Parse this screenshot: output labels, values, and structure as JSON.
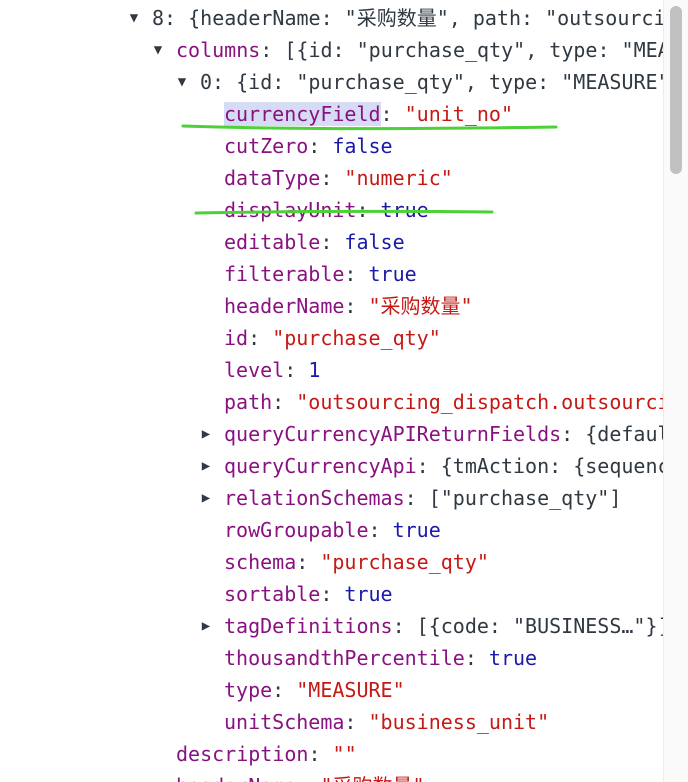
{
  "tree": {
    "rows": [
      {
        "indent": 0,
        "toggle": "expanded",
        "key": "8",
        "value": "{headerName: \"采购数量\", path: \"outsourcing_dispatch.outsourcing_dispatch_detail.purchase_qty\"…}",
        "keyStyle": "index",
        "valueStyle": "punct"
      },
      {
        "indent": 1,
        "toggle": "expanded",
        "key": "columns",
        "value": "[{id: \"purchase_qty\", type: \"MEASURE\"…}]",
        "keyStyle": "prop",
        "valueStyle": "punct"
      },
      {
        "indent": 2,
        "toggle": "expanded",
        "key": "0",
        "value": "{id: \"purchase_qty\", type: \"MEASURE\"…}",
        "keyStyle": "index",
        "valueStyle": "punct"
      },
      {
        "indent": 3,
        "toggle": "none",
        "key": "currencyField",
        "value": "\"unit_no\"",
        "keyStyle": "prop",
        "valueStyle": "string",
        "highlightKey": true
      },
      {
        "indent": 3,
        "toggle": "none",
        "key": "cutZero",
        "value": "false",
        "keyStyle": "prop",
        "valueStyle": "keyword"
      },
      {
        "indent": 3,
        "toggle": "none",
        "key": "dataType",
        "value": "\"numeric\"",
        "keyStyle": "prop",
        "valueStyle": "string"
      },
      {
        "indent": 3,
        "toggle": "none",
        "key": "displayUnit",
        "value": "true",
        "keyStyle": "prop",
        "valueStyle": "keyword"
      },
      {
        "indent": 3,
        "toggle": "none",
        "key": "editable",
        "value": "false",
        "keyStyle": "prop",
        "valueStyle": "keyword"
      },
      {
        "indent": 3,
        "toggle": "none",
        "key": "filterable",
        "value": "true",
        "keyStyle": "prop",
        "valueStyle": "keyword"
      },
      {
        "indent": 3,
        "toggle": "none",
        "key": "headerName",
        "value": "\"采购数量\"",
        "keyStyle": "prop",
        "valueStyle": "string"
      },
      {
        "indent": 3,
        "toggle": "none",
        "key": "id",
        "value": "\"purchase_qty\"",
        "keyStyle": "prop",
        "valueStyle": "string"
      },
      {
        "indent": 3,
        "toggle": "none",
        "key": "level",
        "value": "1",
        "keyStyle": "prop",
        "valueStyle": "keyword"
      },
      {
        "indent": 3,
        "toggle": "none",
        "key": "path",
        "value": "\"outsourcing_dispatch.outsourcing_dispatch_detail.purchase_qty\"",
        "keyStyle": "prop",
        "valueStyle": "string"
      },
      {
        "indent": 3,
        "toggle": "collapsed",
        "key": "queryCurrencyAPIReturnFields",
        "value": "{default: …}",
        "keyStyle": "prop",
        "valueStyle": "punct"
      },
      {
        "indent": 3,
        "toggle": "collapsed",
        "key": "queryCurrencyApi",
        "value": "{tmAction: {sequence: …}}",
        "keyStyle": "prop",
        "valueStyle": "punct"
      },
      {
        "indent": 3,
        "toggle": "collapsed",
        "key": "relationSchemas",
        "value": "[\"purchase_qty\"]",
        "keyStyle": "prop",
        "valueStyle": "punct"
      },
      {
        "indent": 3,
        "toggle": "none",
        "key": "rowGroupable",
        "value": "true",
        "keyStyle": "prop",
        "valueStyle": "keyword"
      },
      {
        "indent": 3,
        "toggle": "none",
        "key": "schema",
        "value": "\"purchase_qty\"",
        "keyStyle": "prop",
        "valueStyle": "string"
      },
      {
        "indent": 3,
        "toggle": "none",
        "key": "sortable",
        "value": "true",
        "keyStyle": "prop",
        "valueStyle": "keyword"
      },
      {
        "indent": 3,
        "toggle": "collapsed",
        "key": "tagDefinitions",
        "value": "[{code: \"BUSINESS…\"}]",
        "keyStyle": "prop",
        "valueStyle": "punct"
      },
      {
        "indent": 3,
        "toggle": "none",
        "key": "thousandthPercentile",
        "value": "true",
        "keyStyle": "prop",
        "valueStyle": "keyword"
      },
      {
        "indent": 3,
        "toggle": "none",
        "key": "type",
        "value": "\"MEASURE\"",
        "keyStyle": "prop",
        "valueStyle": "string"
      },
      {
        "indent": 3,
        "toggle": "none",
        "key": "unitSchema",
        "value": "\"business_unit\"",
        "keyStyle": "prop",
        "valueStyle": "string"
      },
      {
        "indent": 1,
        "toggle": "none",
        "key": "description",
        "value": "\"\"",
        "keyStyle": "prop",
        "valueStyle": "string"
      },
      {
        "indent": 1,
        "toggle": "none",
        "key": "headerName",
        "value": "\"采购数量\"",
        "keyStyle": "prop",
        "valueStyle": "string"
      }
    ],
    "toggle_glyphs": {
      "expanded": "▼",
      "collapsed": "▶"
    }
  },
  "annotation": {
    "color": "#4cd137"
  }
}
